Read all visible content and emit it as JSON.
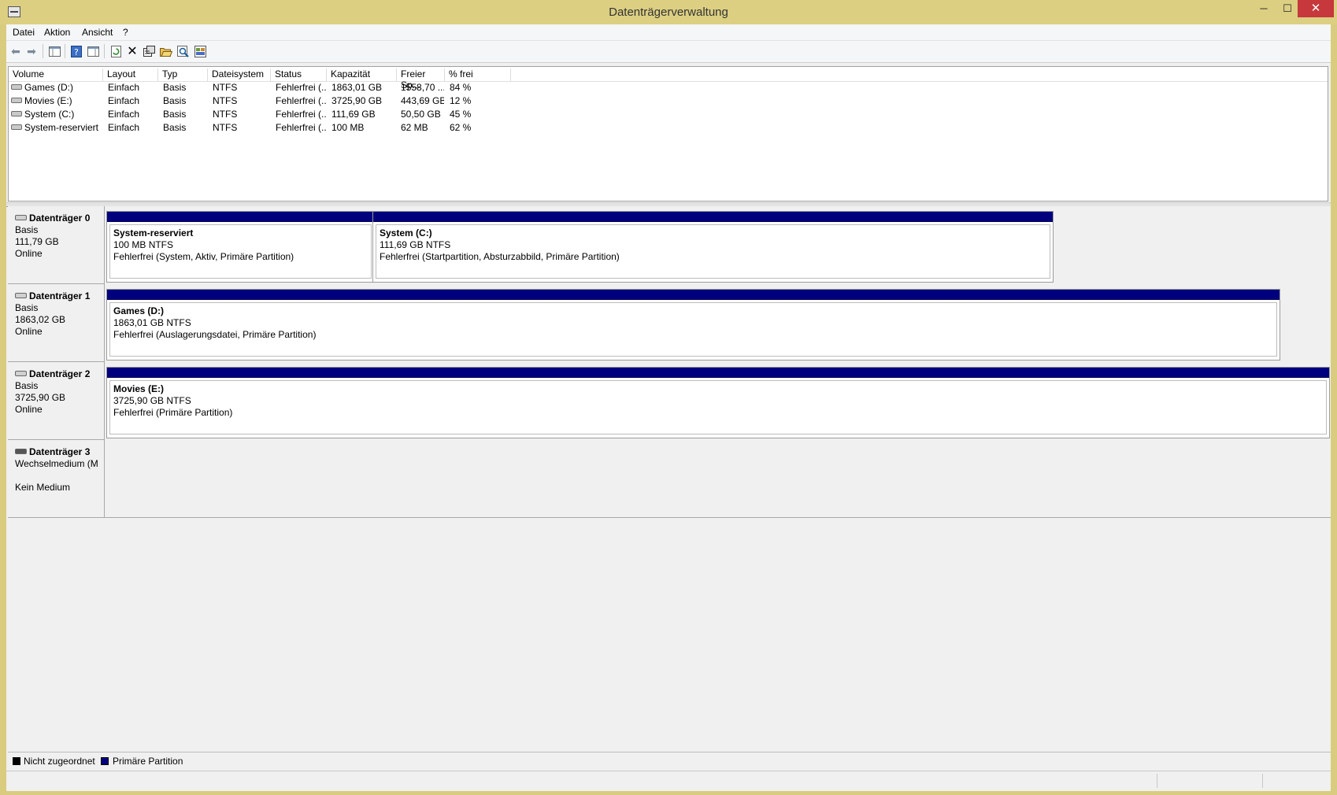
{
  "window": {
    "title": "Datenträgerverwaltung",
    "controls": {
      "minimize": "─",
      "maximize": "☐",
      "close": "✕"
    }
  },
  "menu": [
    "Datei",
    "Aktion",
    "Ansicht",
    "?"
  ],
  "toolbar": {
    "icons": [
      "back-arrow-icon",
      "forward-arrow-icon",
      "console-tree-icon",
      "help-icon",
      "action-pane-icon",
      "refresh-icon",
      "delete-icon",
      "properties-icon",
      "open-icon",
      "search-icon",
      "settings-icon"
    ]
  },
  "volumes": {
    "headers": [
      "Volume",
      "Layout",
      "Typ",
      "Dateisystem",
      "Status",
      "Kapazität",
      "Freier Sp...",
      "% frei"
    ],
    "rows": [
      [
        "Games (D:)",
        "Einfach",
        "Basis",
        "NTFS",
        "Fehlerfrei (...",
        "1863,01 GB",
        "1558,70 ...",
        "84 %"
      ],
      [
        "Movies (E:)",
        "Einfach",
        "Basis",
        "NTFS",
        "Fehlerfrei (...",
        "3725,90 GB",
        "443,69 GB",
        "12 %"
      ],
      [
        "System (C:)",
        "Einfach",
        "Basis",
        "NTFS",
        "Fehlerfrei (...",
        "111,69 GB",
        "50,50 GB",
        "45 %"
      ],
      [
        "System-reserviert",
        "Einfach",
        "Basis",
        "NTFS",
        "Fehlerfrei (...",
        "100 MB",
        "62 MB",
        "62 %"
      ]
    ]
  },
  "disks": [
    {
      "name": "Datenträger 0",
      "type": "Basis",
      "size": "111,79 GB",
      "state": "Online",
      "partitions": [
        {
          "name": "System-reserviert",
          "size": "100 MB NTFS",
          "status": "Fehlerfrei (System, Aktiv, Primäre Partition)"
        },
        {
          "name": "System  (C:)",
          "size": "111,69 GB NTFS",
          "status": "Fehlerfrei (Startpartition, Absturzabbild, Primäre Partition)"
        }
      ]
    },
    {
      "name": "Datenträger 1",
      "type": "Basis",
      "size": "1863,02 GB",
      "state": "Online",
      "partitions": [
        {
          "name": "Games  (D:)",
          "size": "1863,01 GB NTFS",
          "status": "Fehlerfrei (Auslagerungsdatei, Primäre Partition)"
        }
      ]
    },
    {
      "name": "Datenträger 2",
      "type": "Basis",
      "size": "3725,90 GB",
      "state": "Online",
      "partitions": [
        {
          "name": "Movies  (E:)",
          "size": "3725,90 GB NTFS",
          "status": "Fehlerfrei (Primäre Partition)"
        }
      ]
    },
    {
      "name": "Datenträger 3",
      "type": "Wechselmedium (M",
      "size": "",
      "state": "Kein Medium",
      "partitions": []
    }
  ],
  "legend": {
    "items": [
      {
        "label": "Nicht zugeordnet",
        "color": "#000000"
      },
      {
        "label": "Primäre Partition",
        "color": "#00007f"
      }
    ]
  }
}
